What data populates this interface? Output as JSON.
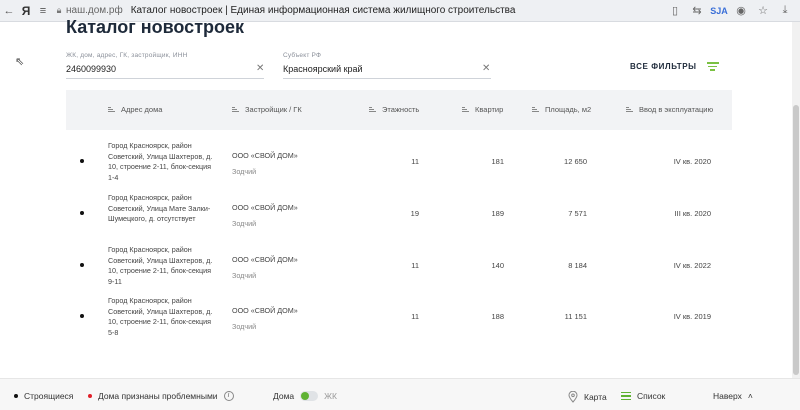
{
  "browser": {
    "logo": "Я",
    "domain": "наш.дом.рф",
    "tab_title": "Каталог новостроек | Единая информационная система жилищного строительства",
    "ext_label": "SJA"
  },
  "page": {
    "title": "Каталог новостроек"
  },
  "search": {
    "label": "ЖК, дом, адрес, ГК, застройщик, ИНН",
    "value": "2460099930"
  },
  "region": {
    "label": "Субъект РФ",
    "value": "Красноярский край"
  },
  "filters_label": "ВСЕ ФИЛЬТРЫ",
  "table": {
    "headers": [
      "Адрес дома",
      "Застройщик / ГК",
      "Этажность",
      "Квартир",
      "Площадь, м2",
      "Ввод в эксплуатацию"
    ],
    "rows": [
      {
        "address": "Город Красноярск, район Советский, Улица Шахтеров, д. 10, строение 2-11, блок-секция 1-4",
        "developer": "ООО «СВОЙ ДОМ»",
        "group": "Зодчий",
        "floors": "11",
        "apartments": "181",
        "area": "12 650",
        "commissioning": "IV кв. 2020"
      },
      {
        "address": "Город Красноярск, район Советский, Улица Мате Залки-Шумецкого, д. отсутствует",
        "developer": "ООО «СВОЙ ДОМ»",
        "group": "Зодчий",
        "floors": "19",
        "apartments": "189",
        "area": "7 571",
        "commissioning": "III кв. 2020"
      },
      {
        "address": "Город Красноярск, район Советский, Улица Шахтеров, д. 10, строение 2-11, блок-секция 9-11",
        "developer": "ООО «СВОЙ ДОМ»",
        "group": "Зодчий",
        "floors": "11",
        "apartments": "140",
        "area": "8 184",
        "commissioning": "IV кв. 2022"
      },
      {
        "address": "Город Красноярск, район Советский, Улица Шахтеров, д. 10, строение 2-11, блок-секция 5-8",
        "developer": "ООО «СВОЙ ДОМ»",
        "group": "Зодчий",
        "floors": "11",
        "apartments": "188",
        "area": "11 151",
        "commissioning": "IV кв. 2019"
      }
    ]
  },
  "footer": {
    "legend_building": "Строящиеся",
    "legend_problem": "Дома признаны проблемными",
    "toggle_left": "Дома",
    "toggle_right": "ЖК",
    "map_label": "Карта",
    "list_label": "Список",
    "up_label": "Наверх"
  },
  "colors": {
    "accent_green": "#5fb233",
    "problem_red": "#e0202a",
    "building_dot": "#111111"
  }
}
